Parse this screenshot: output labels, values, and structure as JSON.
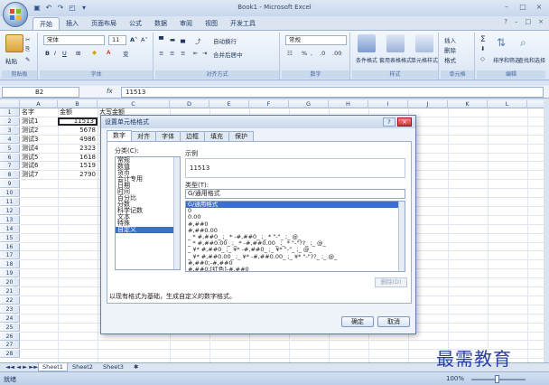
{
  "window": {
    "title": "Book1 - Microsoft Excel",
    "min": "–",
    "max": "□",
    "close": "×"
  },
  "ribbon_tabs": [
    "开始",
    "插入",
    "页面布局",
    "公式",
    "数据",
    "审阅",
    "视图",
    "开发工具"
  ],
  "ribbon_groups": {
    "clipboard": {
      "label": "剪贴板",
      "paste": "粘贴"
    },
    "font": {
      "label": "字体",
      "font_name": "宋体",
      "font_size": "11"
    },
    "alignment": {
      "label": "对齐方式",
      "wrap": "自动换行",
      "merge": "合并后居中"
    },
    "number": {
      "label": "数字",
      "format": "常规"
    },
    "styles": {
      "label": "样式",
      "cond": "条件格式",
      "table": "套用表格格式",
      "cell": "单元格样式"
    },
    "cells": {
      "label": "单元格",
      "insert": "插入",
      "delete": "删除",
      "format": "格式"
    },
    "editing": {
      "label": "编辑",
      "sort": "排序和筛选",
      "find": "查找和选择"
    }
  },
  "formula_bar": {
    "name_box": "B2",
    "fx": "fx",
    "value": "11513"
  },
  "columns": [
    "A",
    "B",
    "C",
    "D",
    "E",
    "F",
    "G",
    "H",
    "I",
    "J",
    "K",
    "L",
    "M"
  ],
  "rows": [
    "1",
    "2",
    "3",
    "4",
    "5",
    "6",
    "7",
    "8",
    "9",
    "10",
    "11",
    "12",
    "13",
    "14",
    "15",
    "16",
    "17",
    "18",
    "19",
    "20",
    "21",
    "22",
    "23",
    "24",
    "25",
    "26",
    "27",
    "28"
  ],
  "cells": [
    {
      "a": "名字",
      "b": "金额",
      "c": "大写金额"
    },
    {
      "a": "测试1",
      "b": "11513",
      "c": ""
    },
    {
      "a": "测试2",
      "b": "5678",
      "c": ""
    },
    {
      "a": "测试3",
      "b": "4986",
      "c": ""
    },
    {
      "a": "测试4",
      "b": "2323",
      "c": ""
    },
    {
      "a": "测试5",
      "b": "1618",
      "c": ""
    },
    {
      "a": "测试6",
      "b": "1519",
      "c": ""
    },
    {
      "a": "测试7",
      "b": "2790",
      "c": ""
    }
  ],
  "sheets": [
    "Sheet1",
    "Sheet2",
    "Sheet3"
  ],
  "status": {
    "ready": "就绪",
    "zoom": "100%"
  },
  "dialog": {
    "title": "设置单元格格式",
    "help": "?",
    "close": "×",
    "tabs": [
      "数字",
      "对齐",
      "字体",
      "边框",
      "填充",
      "保护"
    ],
    "category_label": "分类(C):",
    "categories": [
      "常规",
      "数值",
      "货币",
      "会计专用",
      "日期",
      "时间",
      "百分比",
      "分数",
      "科学记数",
      "文本",
      "特殊",
      "自定义"
    ],
    "selected_category": "自定义",
    "sample_label": "示例",
    "sample_value": "11513",
    "type_label": "类型(T):",
    "type_value": "G/通用格式",
    "types": [
      "G/通用格式",
      "0",
      "0.00",
      "#,##0",
      "#,##0.00",
      "_ * #,##0_ ;_ * -#,##0_ ;_ * \"-\"_ ;_ @_",
      "_ * #,##0.00_ ;_ * -#,##0.00_ ;_ * \"-\"??_ ;_ @_",
      "_ ¥* #,##0_ ;_ ¥* -#,##0_ ;_ ¥* \"-\"_ ;_ @_",
      "_ ¥* #,##0.00_ ;_ ¥* -#,##0.00_ ;_ ¥* \"-\"??_ ;_ @_",
      "#,##0;-#,##0",
      "#,##0;[红色]-#,##0"
    ],
    "delete_label": "删除(D)",
    "description": "以现有格式为基础，生成自定义的数字格式。",
    "ok": "确定",
    "cancel": "取消"
  },
  "watermark": "最需教育",
  "colors": {
    "accent": "#3a6fd0",
    "frame": "#dbe5f2",
    "watermark": "#2a3fa6"
  }
}
